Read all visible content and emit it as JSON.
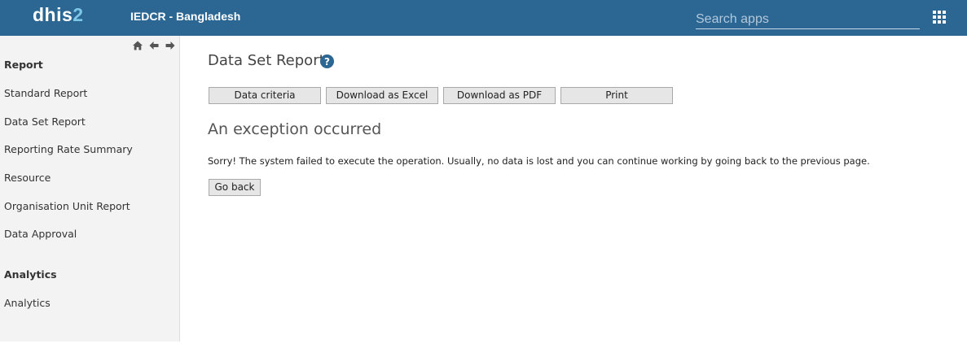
{
  "header": {
    "logo_main": "dhis",
    "logo_accent": "2",
    "instance_name": "IEDCR - Bangladesh",
    "search_placeholder": "Search apps",
    "apps_icon": "grid-icon",
    "bg_color": "#2c6693"
  },
  "sidebar": {
    "nav_icons": [
      "home-icon",
      "arrow-left-icon",
      "arrow-right-icon"
    ],
    "sections": [
      {
        "heading": "Report",
        "items": [
          "Standard Report",
          "Data Set Report",
          "Reporting Rate Summary",
          "Resource",
          "Organisation Unit Report",
          "Data Approval"
        ]
      },
      {
        "heading": "Analytics",
        "items": [
          "Analytics"
        ]
      }
    ]
  },
  "main": {
    "title": "Data Set Report",
    "help_icon": "question-circle-icon",
    "buttons": [
      "Data criteria",
      "Download as Excel",
      "Download as PDF",
      "Print"
    ],
    "error_title": "An exception occurred",
    "error_message": "Sorry! The system failed to execute the operation. Usually, no data is lost and you can continue working by going back to the previous page.",
    "back_button": "Go back"
  }
}
